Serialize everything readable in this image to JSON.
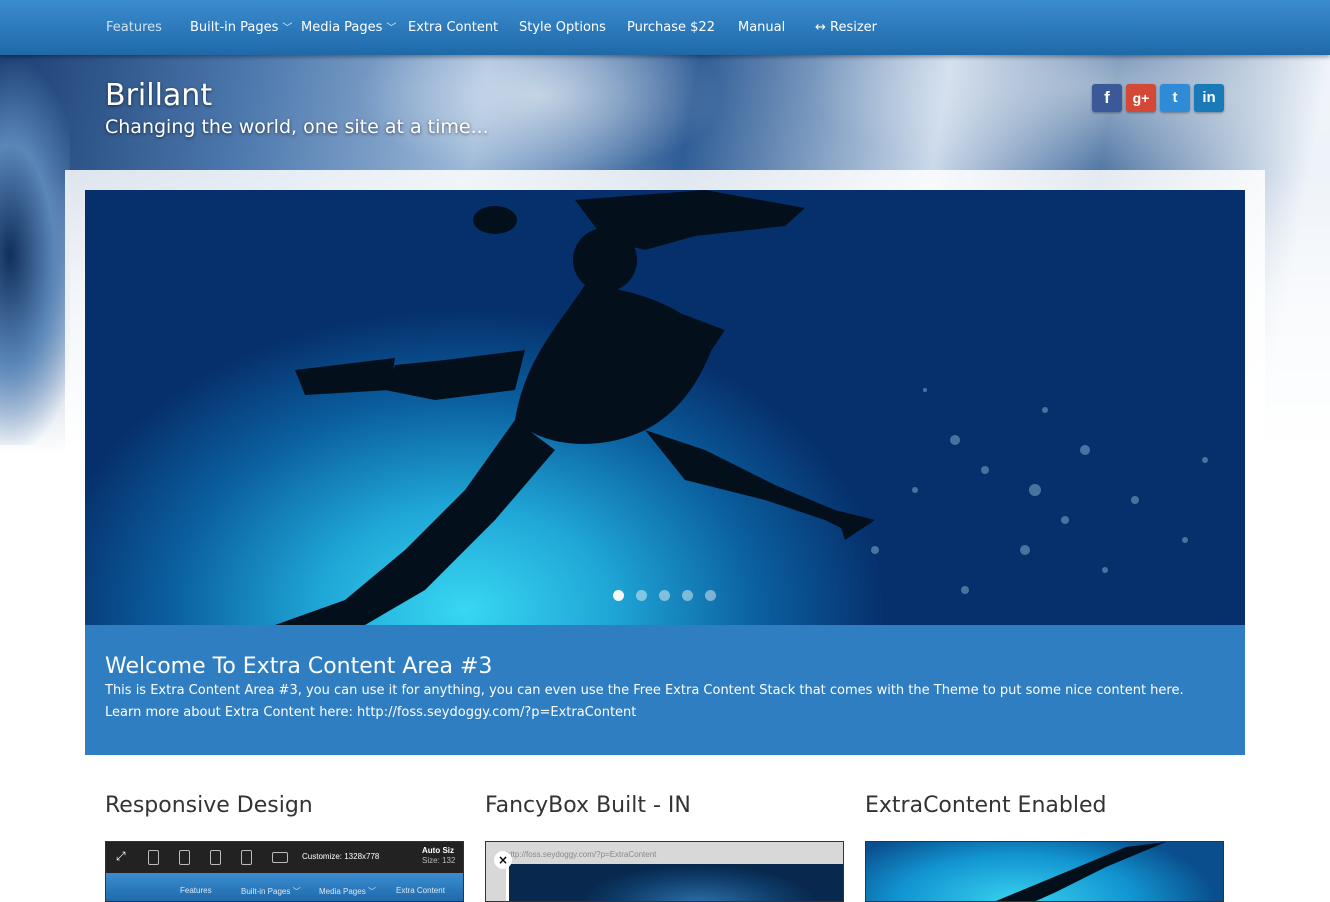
{
  "nav": {
    "items": [
      {
        "label": "Features",
        "caret": ""
      },
      {
        "label": "Built-in Pages",
        "caret": "﹀"
      },
      {
        "label": "Media Pages",
        "caret": "﹀"
      },
      {
        "label": "Extra Content",
        "caret": ""
      },
      {
        "label": "Style Options",
        "caret": ""
      },
      {
        "label": "Purchase $22",
        "caret": ""
      },
      {
        "label": "Manual",
        "caret": ""
      },
      {
        "label": "↔ Resizer",
        "caret": ""
      }
    ]
  },
  "header": {
    "title": "Brillant",
    "tagline": "Changing the world, one site at a time..."
  },
  "social": [
    {
      "label": "f",
      "icon": "facebook-icon",
      "color": "#3b5998"
    },
    {
      "label": "g+",
      "icon": "google-plus-icon",
      "color": "#d34836"
    },
    {
      "label": "t",
      "icon": "twitter-icon",
      "color": "#2f8bd6"
    },
    {
      "label": "in",
      "icon": "linkedin-icon",
      "color": "#1a7ab8"
    }
  ],
  "slider": {
    "dots": 5,
    "active_dot": 1
  },
  "extra": {
    "title": "Welcome To Extra Content Area #3",
    "line1": "This is Extra Content Area #3, you can use it for anything, you can even use the Free Extra Content Stack that comes with the Theme to put some nice content here.",
    "line2": "Learn more about Extra Content here: http://foss.seydoggy.com/?p=ExtraContent"
  },
  "columns": [
    {
      "title": "Responsive Design"
    },
    {
      "title": "FancyBox Built - IN"
    },
    {
      "title": "ExtraContent Enabled"
    }
  ],
  "thumb1": {
    "customize": "Customize: 1328x778",
    "auto": "Auto Siz",
    "size": "Size: 132",
    "nav": [
      "Features",
      "Built-in Pages ﹀",
      "Media Pages ﹀",
      "Extra Content"
    ]
  },
  "thumb2": {
    "url": "http://foss.seydoggy.com/?p=ExtraContent",
    "close": "×"
  },
  "colors": {
    "nav_bg": "#2a78bd",
    "extra_bg": "#2f7ec1",
    "heading_text": "#333333"
  }
}
